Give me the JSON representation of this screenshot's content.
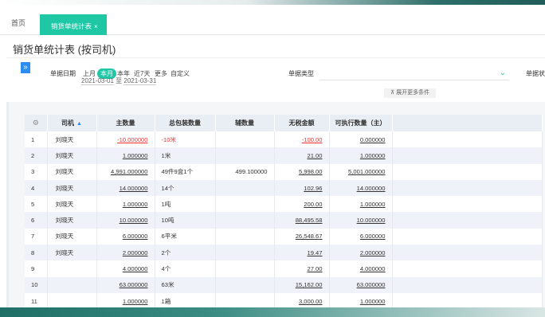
{
  "tabs": {
    "home": "首页",
    "active": "销货单统计表",
    "close": "×"
  },
  "page_title": "销货单统计表 (按司机)",
  "filter": {
    "expand_icon": "»",
    "date_label": "单据日期",
    "quick": [
      "上月",
      "本月",
      "本年",
      "近7天",
      "更多",
      "自定义"
    ],
    "quick_active": "本月",
    "date_from": "2021-03-01",
    "date_sep": "至",
    "date_to": "2021-03-31",
    "type_label": "单据类型",
    "type_value": "",
    "right_label": "单据状",
    "more_conditions": "展开更多条件"
  },
  "table": {
    "headers": [
      "",
      "司机",
      "主数量",
      "总包装数量",
      "辅数量",
      "无税金额",
      "可执行数量（主）",
      ""
    ],
    "rows": [
      {
        "idx": "1",
        "driver": "刘晓天",
        "main_qty": "-10.000000",
        "pkg_qty": "-10米",
        "aux_qty": "",
        "amount": "-100.00",
        "exec_qty": "0.000000",
        "red": true
      },
      {
        "idx": "2",
        "driver": "刘晓天",
        "main_qty": "1.000000",
        "pkg_qty": "1米",
        "aux_qty": "",
        "amount": "21.00",
        "exec_qty": "1.000000",
        "red": false
      },
      {
        "idx": "3",
        "driver": "刘晓天",
        "main_qty": "4,991.000000",
        "pkg_qty": "49件9盒1个",
        "aux_qty": "499.100000",
        "amount": "5,998.00",
        "exec_qty": "5,001.000000",
        "red": false
      },
      {
        "idx": "4",
        "driver": "刘晓天",
        "main_qty": "14.000000",
        "pkg_qty": "14个",
        "aux_qty": "",
        "amount": "102.96",
        "exec_qty": "14.000000",
        "red": false
      },
      {
        "idx": "5",
        "driver": "刘晓天",
        "main_qty": "1.000000",
        "pkg_qty": "1吨",
        "aux_qty": "",
        "amount": "200.00",
        "exec_qty": "1.000000",
        "red": false
      },
      {
        "idx": "6",
        "driver": "刘晓天",
        "main_qty": "10.000000",
        "pkg_qty": "10吨",
        "aux_qty": "",
        "amount": "88,495.58",
        "exec_qty": "10.000000",
        "red": false
      },
      {
        "idx": "7",
        "driver": "刘晓天",
        "main_qty": "6.000000",
        "pkg_qty": "6平米",
        "aux_qty": "",
        "amount": "26,548.67",
        "exec_qty": "6.000000",
        "red": false
      },
      {
        "idx": "8",
        "driver": "刘晓天",
        "main_qty": "2.000000",
        "pkg_qty": "2个",
        "aux_qty": "",
        "amount": "19.47",
        "exec_qty": "2.000000",
        "red": false
      },
      {
        "idx": "9",
        "driver": "",
        "main_qty": "4.000000",
        "pkg_qty": "4个",
        "aux_qty": "",
        "amount": "27.00",
        "exec_qty": "4.000000",
        "red": false
      },
      {
        "idx": "10",
        "driver": "",
        "main_qty": "63.000000",
        "pkg_qty": "63米",
        "aux_qty": "",
        "amount": "15,162.00",
        "exec_qty": "63.000000",
        "red": false
      },
      {
        "idx": "11",
        "driver": "",
        "main_qty": "1.000000",
        "pkg_qty": "1箱",
        "aux_qty": "",
        "amount": "3,000.00",
        "exec_qty": "1.000000",
        "red": false
      }
    ]
  },
  "colors": {
    "accent": "#1fc7a5",
    "blue": "#2d8cf0",
    "negative": "#e33333",
    "header_bg": "#e9edf4"
  }
}
